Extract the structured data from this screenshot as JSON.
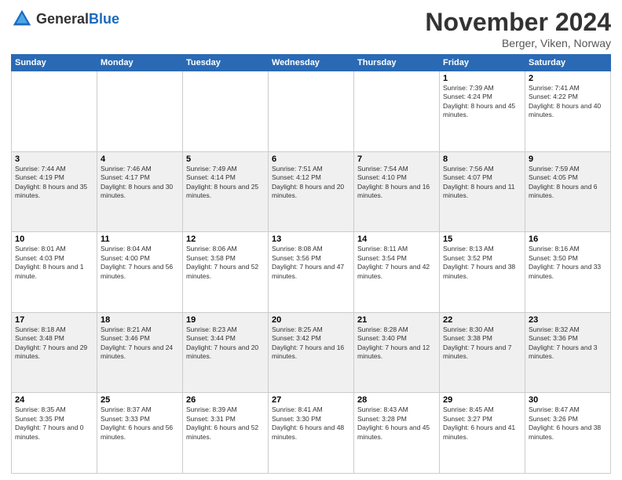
{
  "header": {
    "logo_general": "General",
    "logo_blue": "Blue",
    "month_title": "November 2024",
    "location": "Berger, Viken, Norway"
  },
  "weekdays": [
    "Sunday",
    "Monday",
    "Tuesday",
    "Wednesday",
    "Thursday",
    "Friday",
    "Saturday"
  ],
  "weeks": [
    [
      {
        "day": "",
        "info": ""
      },
      {
        "day": "",
        "info": ""
      },
      {
        "day": "",
        "info": ""
      },
      {
        "day": "",
        "info": ""
      },
      {
        "day": "",
        "info": ""
      },
      {
        "day": "1",
        "info": "Sunrise: 7:39 AM\nSunset: 4:24 PM\nDaylight: 8 hours and 45 minutes."
      },
      {
        "day": "2",
        "info": "Sunrise: 7:41 AM\nSunset: 4:22 PM\nDaylight: 8 hours and 40 minutes."
      }
    ],
    [
      {
        "day": "3",
        "info": "Sunrise: 7:44 AM\nSunset: 4:19 PM\nDaylight: 8 hours and 35 minutes."
      },
      {
        "day": "4",
        "info": "Sunrise: 7:46 AM\nSunset: 4:17 PM\nDaylight: 8 hours and 30 minutes."
      },
      {
        "day": "5",
        "info": "Sunrise: 7:49 AM\nSunset: 4:14 PM\nDaylight: 8 hours and 25 minutes."
      },
      {
        "day": "6",
        "info": "Sunrise: 7:51 AM\nSunset: 4:12 PM\nDaylight: 8 hours and 20 minutes."
      },
      {
        "day": "7",
        "info": "Sunrise: 7:54 AM\nSunset: 4:10 PM\nDaylight: 8 hours and 16 minutes."
      },
      {
        "day": "8",
        "info": "Sunrise: 7:56 AM\nSunset: 4:07 PM\nDaylight: 8 hours and 11 minutes."
      },
      {
        "day": "9",
        "info": "Sunrise: 7:59 AM\nSunset: 4:05 PM\nDaylight: 8 hours and 6 minutes."
      }
    ],
    [
      {
        "day": "10",
        "info": "Sunrise: 8:01 AM\nSunset: 4:03 PM\nDaylight: 8 hours and 1 minute."
      },
      {
        "day": "11",
        "info": "Sunrise: 8:04 AM\nSunset: 4:00 PM\nDaylight: 7 hours and 56 minutes."
      },
      {
        "day": "12",
        "info": "Sunrise: 8:06 AM\nSunset: 3:58 PM\nDaylight: 7 hours and 52 minutes."
      },
      {
        "day": "13",
        "info": "Sunrise: 8:08 AM\nSunset: 3:56 PM\nDaylight: 7 hours and 47 minutes."
      },
      {
        "day": "14",
        "info": "Sunrise: 8:11 AM\nSunset: 3:54 PM\nDaylight: 7 hours and 42 minutes."
      },
      {
        "day": "15",
        "info": "Sunrise: 8:13 AM\nSunset: 3:52 PM\nDaylight: 7 hours and 38 minutes."
      },
      {
        "day": "16",
        "info": "Sunrise: 8:16 AM\nSunset: 3:50 PM\nDaylight: 7 hours and 33 minutes."
      }
    ],
    [
      {
        "day": "17",
        "info": "Sunrise: 8:18 AM\nSunset: 3:48 PM\nDaylight: 7 hours and 29 minutes."
      },
      {
        "day": "18",
        "info": "Sunrise: 8:21 AM\nSunset: 3:46 PM\nDaylight: 7 hours and 24 minutes."
      },
      {
        "day": "19",
        "info": "Sunrise: 8:23 AM\nSunset: 3:44 PM\nDaylight: 7 hours and 20 minutes."
      },
      {
        "day": "20",
        "info": "Sunrise: 8:25 AM\nSunset: 3:42 PM\nDaylight: 7 hours and 16 minutes."
      },
      {
        "day": "21",
        "info": "Sunrise: 8:28 AM\nSunset: 3:40 PM\nDaylight: 7 hours and 12 minutes."
      },
      {
        "day": "22",
        "info": "Sunrise: 8:30 AM\nSunset: 3:38 PM\nDaylight: 7 hours and 7 minutes."
      },
      {
        "day": "23",
        "info": "Sunrise: 8:32 AM\nSunset: 3:36 PM\nDaylight: 7 hours and 3 minutes."
      }
    ],
    [
      {
        "day": "24",
        "info": "Sunrise: 8:35 AM\nSunset: 3:35 PM\nDaylight: 7 hours and 0 minutes."
      },
      {
        "day": "25",
        "info": "Sunrise: 8:37 AM\nSunset: 3:33 PM\nDaylight: 6 hours and 56 minutes."
      },
      {
        "day": "26",
        "info": "Sunrise: 8:39 AM\nSunset: 3:31 PM\nDaylight: 6 hours and 52 minutes."
      },
      {
        "day": "27",
        "info": "Sunrise: 8:41 AM\nSunset: 3:30 PM\nDaylight: 6 hours and 48 minutes."
      },
      {
        "day": "28",
        "info": "Sunrise: 8:43 AM\nSunset: 3:28 PM\nDaylight: 6 hours and 45 minutes."
      },
      {
        "day": "29",
        "info": "Sunrise: 8:45 AM\nSunset: 3:27 PM\nDaylight: 6 hours and 41 minutes."
      },
      {
        "day": "30",
        "info": "Sunrise: 8:47 AM\nSunset: 3:26 PM\nDaylight: 6 hours and 38 minutes."
      }
    ]
  ]
}
